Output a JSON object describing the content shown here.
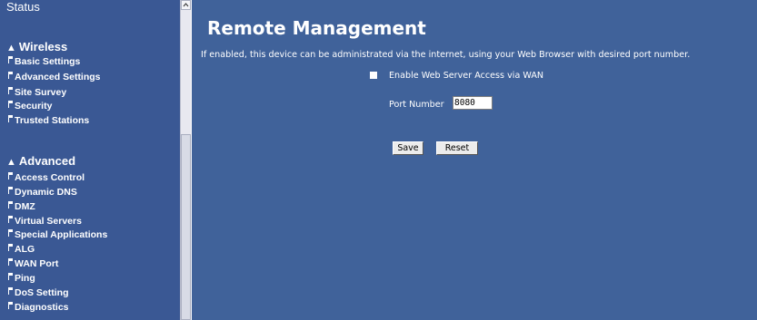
{
  "sidebar": {
    "status_title": "Status",
    "sections": [
      {
        "title": "Wireless",
        "items": [
          "Basic Settings",
          "Advanced Settings",
          "Site Survey",
          "Security",
          "Trusted Stations"
        ]
      },
      {
        "title": "Advanced",
        "items": [
          "Access Control",
          "Dynamic DNS",
          "DMZ",
          "Virtual Servers",
          "Special Applications",
          "ALG",
          "WAN Port",
          "Ping",
          "DoS Setting",
          "Diagnostics"
        ]
      }
    ]
  },
  "main": {
    "title": "Remote Management",
    "description": "If enabled, this device can be administrated via the internet, using your Web Browser with desired port number.",
    "enable_label": "Enable Web Server Access via WAN",
    "enable_checked": false,
    "port_label": "Port Number",
    "port_value": "8080",
    "save_label": "Save",
    "reset_label": "Reset"
  },
  "colors": {
    "sidebar_bg": "#3a5894",
    "main_bg": "#40629a",
    "text": "#ffffff"
  },
  "icons": {
    "section_marker": "triangle-up-icon",
    "item_marker": "flag-icon"
  }
}
